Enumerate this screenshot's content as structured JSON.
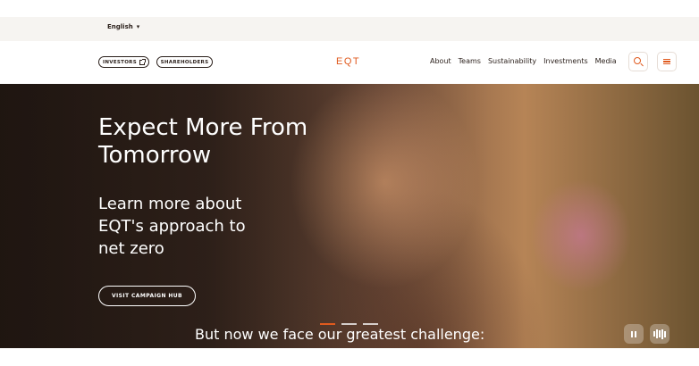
{
  "topbar": {
    "language": "English"
  },
  "header": {
    "investors_label": "INVESTORS",
    "shareholders_label": "SHAREHOLDERS",
    "logo": "EQT",
    "nav": [
      "About",
      "Teams",
      "Sustainability",
      "Investments",
      "Media"
    ]
  },
  "hero": {
    "headline": "Expect More From Tomorrow",
    "subhead": "Learn more about EQT's approach to net zero",
    "cta_label": "VISIT CAMPAIGN HUB",
    "bottom_text": "But now we face our greatest challenge:",
    "slides_total": 3,
    "active_slide": 1
  },
  "colors": {
    "accent": "#e05a1e",
    "text_dark": "#2a1f1a",
    "topbar_bg": "#f6f4f1"
  },
  "icons": [
    "chevron-down-icon",
    "external-link-icon",
    "search-icon",
    "menu-icon",
    "pause-icon",
    "audio-bars-icon"
  ]
}
